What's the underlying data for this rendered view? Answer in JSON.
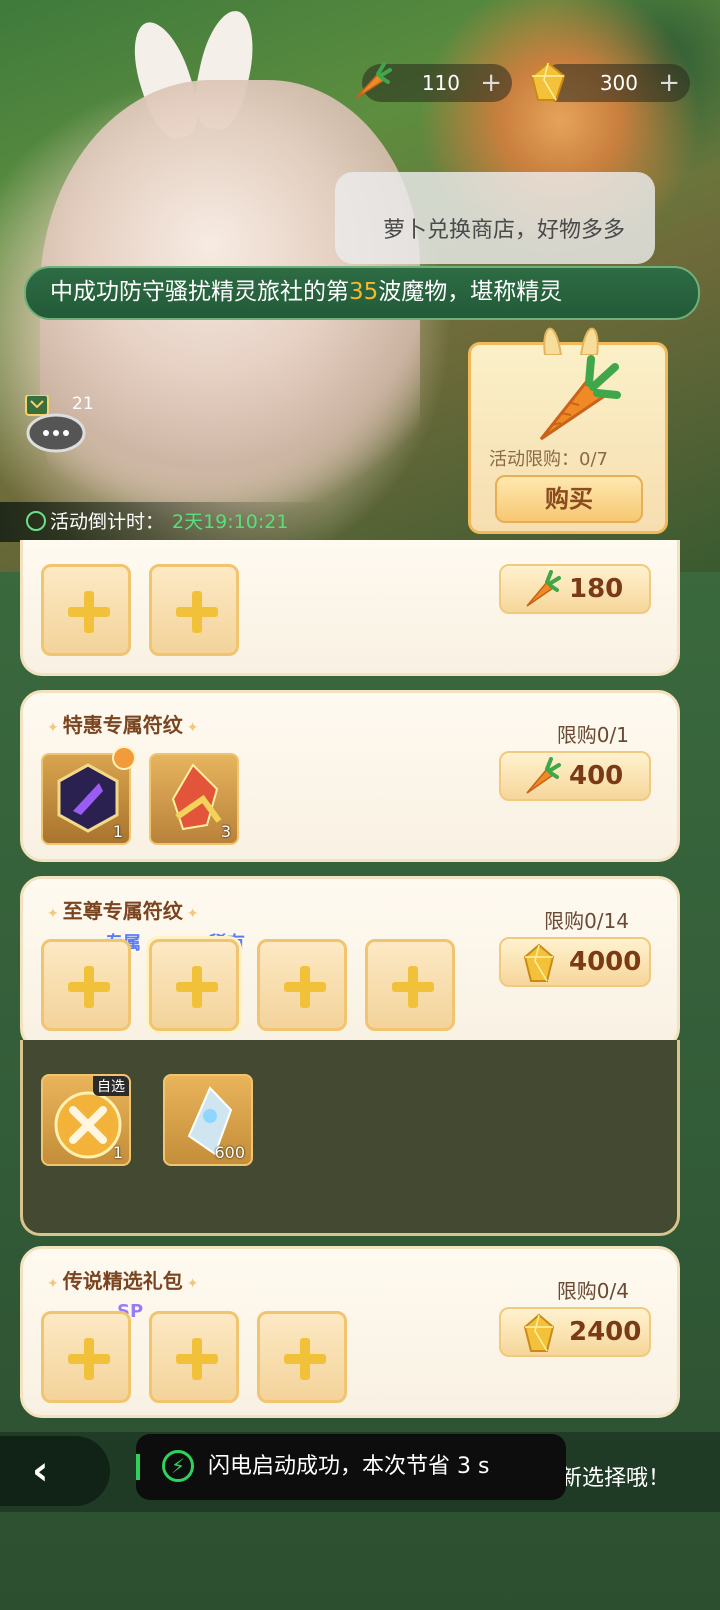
{
  "resources": {
    "carrot_count": "110",
    "gem_count": "300",
    "plus": "+"
  },
  "banner": {
    "speech": "萝卜兑换商店，好物多多",
    "marquee_pre": "中成功防守骚扰精灵旅社的第",
    "marquee_num": "35",
    "marquee_post": "波魔物，堪称精灵",
    "chat_count": "21",
    "countdown_label": "活动倒计时：",
    "countdown_time": "2天19:10:21"
  },
  "featured": {
    "limit": "活动限购：0/7",
    "buy_label": "购买"
  },
  "cards": [
    {
      "title": "",
      "limit": "",
      "price": "180",
      "currency": "carrot-icon"
    },
    {
      "title": "特惠专属符纹",
      "limit": "限购0/1",
      "price": "400",
      "currency": "carrot-icon",
      "items": [
        {
          "name": "purple-rune-icon",
          "count": "1"
        },
        {
          "name": "red-crystal-icon",
          "count": "3"
        }
      ]
    },
    {
      "title": "至尊专属符纹",
      "limit": "限购0/14",
      "price": "4000",
      "currency": "gem-icon",
      "tags": [
        "专属",
        "稀有"
      ]
    },
    {
      "title": "传说精选礼包",
      "limit": "限购0/4",
      "price": "2400",
      "currency": "gem-icon",
      "tags": [
        "SP"
      ]
    }
  ],
  "drawer": {
    "items": [
      {
        "name": "selectable-coin-icon",
        "tag": "自选",
        "count": "1"
      },
      {
        "name": "blue-crystal-icon",
        "count": "600"
      }
    ]
  },
  "footer": {
    "back": "‹",
    "hint": "新选择哦！",
    "toast": "闪电启动成功，本次节省 3 s"
  },
  "colors": {
    "accent_gold": "#f2c13a",
    "brand_green": "#2d6c44",
    "highlight": "#f5b833",
    "countdown_green": "#57e07a"
  }
}
